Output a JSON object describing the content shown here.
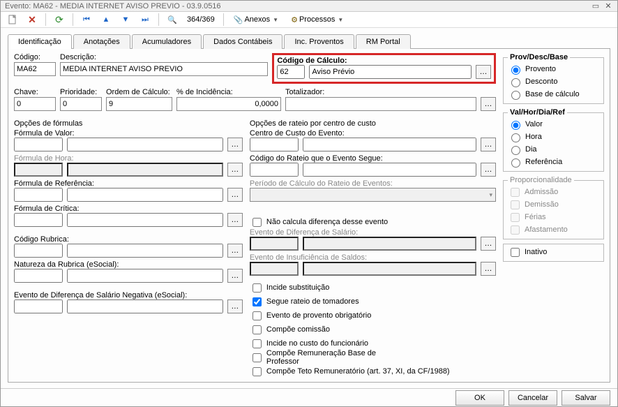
{
  "window": {
    "title": "Evento: MA62 - MEDIA INTERNET AVISO PREVIO - 03.9.0516"
  },
  "toolbar": {
    "counter": "364/369",
    "anexos": "Anexos",
    "processos": "Processos"
  },
  "tabs": [
    "Identificação",
    "Anotações",
    "Acumuladores",
    "Dados Contábeis",
    "Inc. Proventos",
    "RM Portal"
  ],
  "fields": {
    "codigo_label": "Código:",
    "codigo": "MA62",
    "descricao_label": "Descrição:",
    "descricao": "MEDIA INTERNET AVISO PREVIO",
    "chave_label": "Chave:",
    "chave": "0",
    "prioridade_label": "Prioridade:",
    "prioridade": "0",
    "ordem_label": "Ordem de Cálculo:",
    "ordem": "9",
    "pct_label": "% de Incidência:",
    "pct": "0,0000",
    "totalizador_label": "Totalizador:",
    "totalizador": "",
    "cod_calc_label": "Código de Cálculo:",
    "cod_calc_num": "62",
    "cod_calc_desc": "Aviso Prévio"
  },
  "formulas": {
    "title": "Opções de fórmulas",
    "valor_label": "Fórmula de Valor:",
    "hora_label": "Fórmula de Hora:",
    "ref_label": "Fórmula de Referência:",
    "critica_label": "Fórmula de Crítica:",
    "rubrica_label": "Código Rubrica:",
    "natureza_label": "Natureza da Rubrica (eSocial):",
    "dif_neg_label": "Evento de Diferença de Salário Negativa (eSocial):"
  },
  "rateio": {
    "title": "Opções de rateio por centro de custo",
    "centro_label": "Centro de Custo do Evento:",
    "codigo_rateio_label": "Código do Rateio que o Evento Segue:",
    "periodo_label": "Período de Cálculo do Rateio de Eventos:"
  },
  "extras": {
    "nao_calcula": "Não calcula diferença desse evento",
    "dif_salario_label": "Evento de Diferença de Salário:",
    "insuf_saldo_label": "Evento de Insuficiência de Saldos:",
    "incide_sub": "Incide substituição",
    "segue_tomadores": "Segue rateio de tomadores",
    "provento_obrig": "Evento de provento obrigatório",
    "compoe_comissao": "Compõe comissão",
    "incide_func": "Incide no custo do funcionário",
    "compoe_prof": "Compõe Remuneração Base de Professor",
    "teto": "Compõe Teto Remuneratório (art. 37, XI, da CF/1988)"
  },
  "side": {
    "prov_title": "Prov/Desc/Base",
    "provento": "Provento",
    "desconto": "Desconto",
    "base": "Base de cálculo",
    "val_title": "Val/Hor/Dia/Ref",
    "valor": "Valor",
    "hora": "Hora",
    "dia": "Dia",
    "referencia": "Referência",
    "prop_title": "Proporcionalidade",
    "admissao": "Admissão",
    "demissao": "Demissão",
    "ferias": "Férias",
    "afast": "Afastamento",
    "inativo": "Inativo"
  },
  "buttons": {
    "ok": "OK",
    "cancelar": "Cancelar",
    "salvar": "Salvar"
  }
}
